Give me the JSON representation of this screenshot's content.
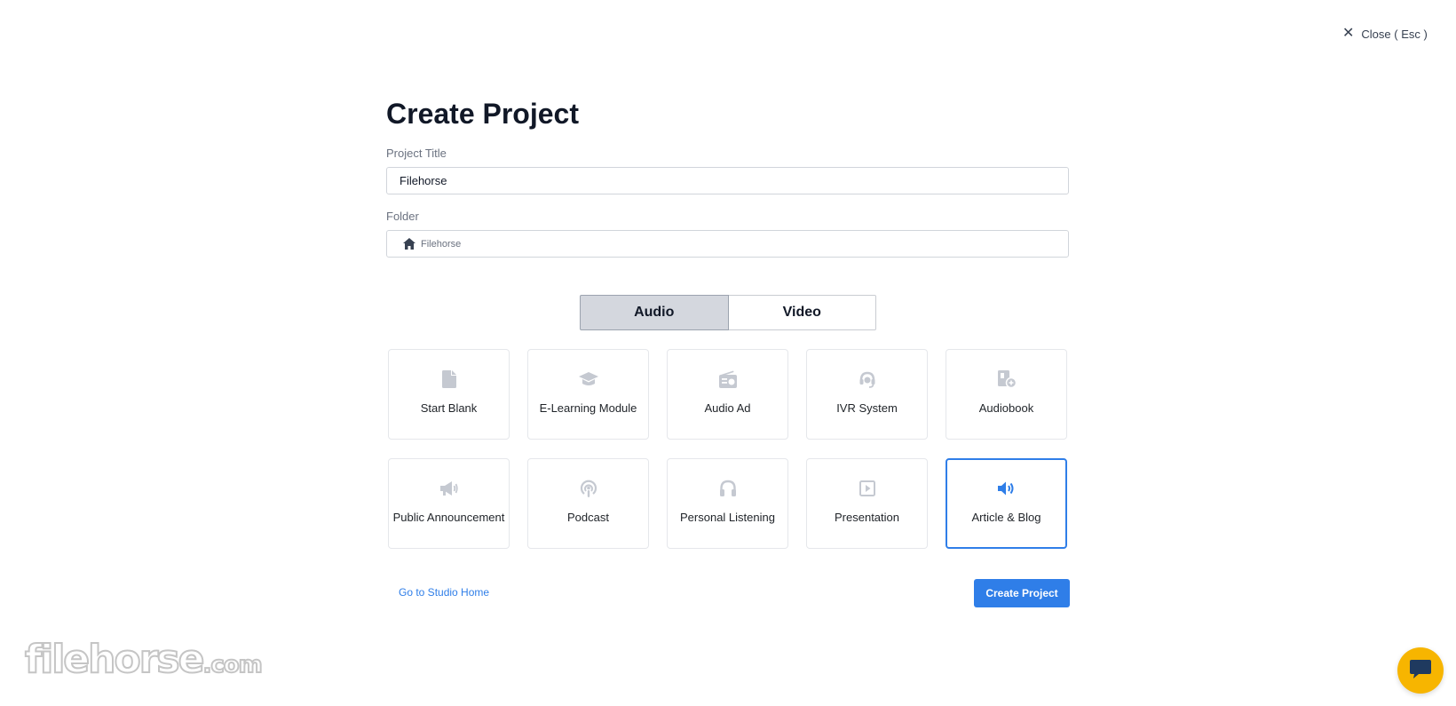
{
  "close": {
    "label": "Close ( Esc )",
    "icon": "close-icon"
  },
  "page": {
    "title": "Create Project"
  },
  "form": {
    "project_title_label": "Project Title",
    "project_title_value": "Filehorse",
    "folder_label": "Folder",
    "folder_value": "Filehorse",
    "folder_icon": "home-icon"
  },
  "toggle": {
    "audio_label": "Audio",
    "video_label": "Video",
    "selected": "Audio"
  },
  "templates": [
    {
      "label": "Start Blank",
      "icon": "file-icon"
    },
    {
      "label": "E-Learning Module",
      "icon": "graduation-cap-icon"
    },
    {
      "label": "Audio Ad",
      "icon": "radio-icon"
    },
    {
      "label": "IVR System",
      "icon": "headset-icon"
    },
    {
      "label": "Audiobook",
      "icon": "audiobook-icon"
    },
    {
      "label": "Public Announcement",
      "icon": "megaphone-icon"
    },
    {
      "label": "Podcast",
      "icon": "podcast-icon"
    },
    {
      "label": "Personal Listening",
      "icon": "headphones-icon"
    },
    {
      "label": "Presentation",
      "icon": "play-square-icon"
    },
    {
      "label": "Article & Blog",
      "icon": "volume-icon",
      "selected": true
    }
  ],
  "footer": {
    "studio_home_link": "Go to Studio Home",
    "create_button": "Create Project"
  },
  "watermark": {
    "brand": "filehorse",
    "suffix": ".com"
  },
  "colors": {
    "accent": "#2f7ee8",
    "icon_muted": "#c5c9d1",
    "chat": "#f7b500",
    "toggle_active_bg": "#d4d7de"
  }
}
